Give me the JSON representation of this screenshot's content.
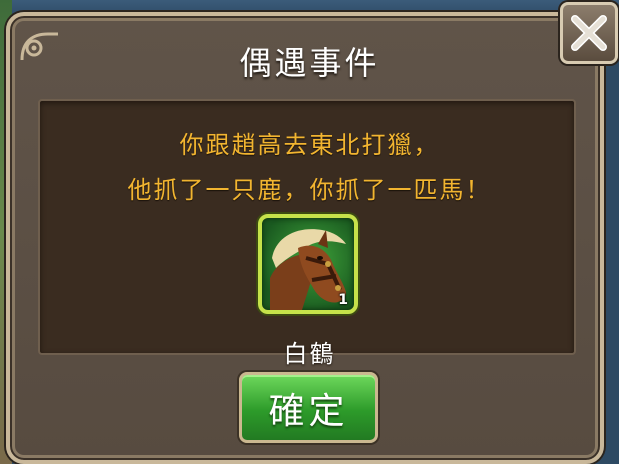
{
  "dialog": {
    "title": "偶遇事件",
    "message_line1": "你跟趙高去東北打獵，",
    "message_line2": "他抓了一只鹿，你抓了一匹馬！",
    "reward": {
      "icon": "horse-icon",
      "name": "白鶴",
      "count": "1"
    },
    "confirm_label": "確定",
    "close_icon": "close-icon"
  },
  "colors": {
    "message_text": "#f2b530",
    "title_text": "#ffffff",
    "confirm_button": "#2d9b2a",
    "item_border": "#c6e24a"
  }
}
